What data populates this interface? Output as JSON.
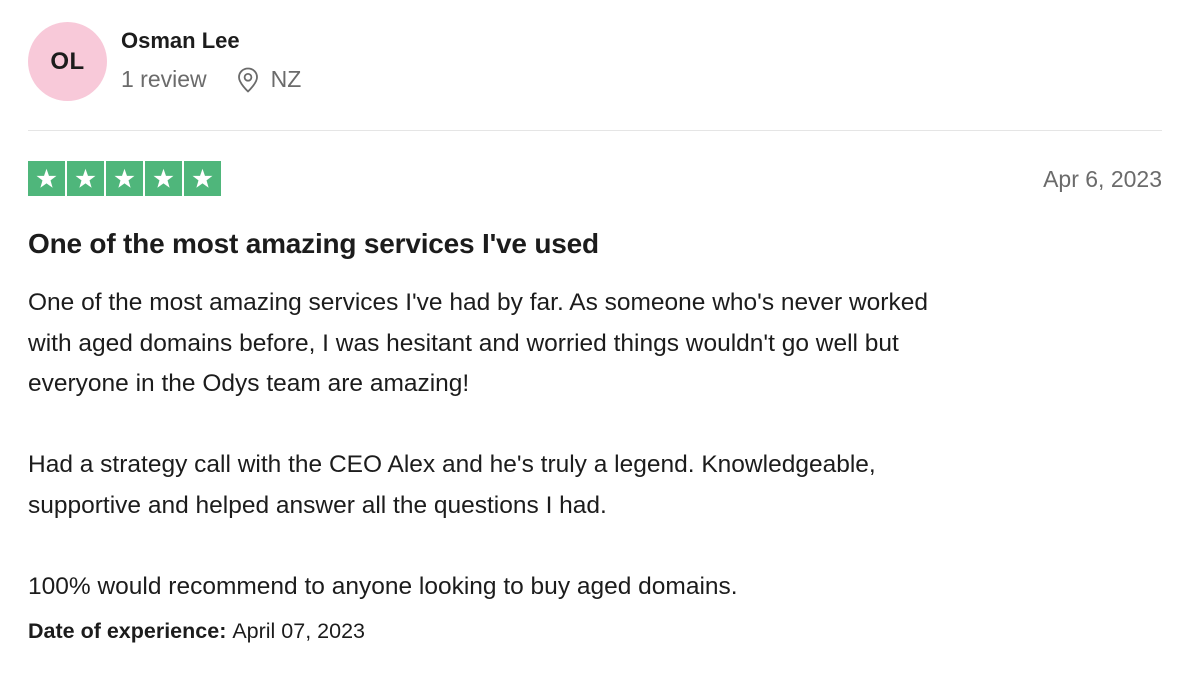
{
  "author": {
    "initials": "OL",
    "name": "Osman Lee",
    "review_count": "1 review",
    "location_icon": "location-pin-icon",
    "country": "NZ",
    "avatar_color": "#f8c9d9"
  },
  "rating": {
    "stars": 5,
    "max": 5,
    "star_color": "#4fb67b"
  },
  "review": {
    "date": "Apr 6, 2023",
    "title": "One of the most amazing services I've used",
    "body_lines": [
      "One of the most amazing services I've had by far. As someone who's never worked",
      "with aged domains before, I was hesitant and worried things wouldn't go well but",
      "everyone in the Odys team are amazing!",
      "Had a strategy call with the CEO Alex and he's truly a legend. Knowledgeable,",
      "supportive and helped answer all the questions I had.",
      "100% would recommend to anyone looking to buy aged domains."
    ],
    "experience_label": "Date of experience:",
    "experience_date": "April 07, 2023"
  }
}
